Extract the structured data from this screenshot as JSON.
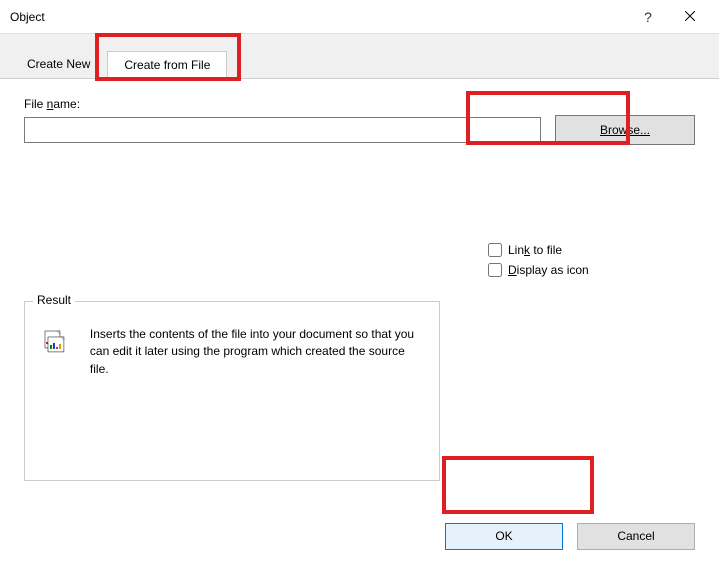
{
  "titlebar": {
    "title": "Object"
  },
  "tabs": {
    "create_new": "Create New",
    "create_from_file": "Create from File"
  },
  "file": {
    "label_pre": "File ",
    "label_key": "n",
    "label_post": "ame:",
    "value": "",
    "browse": "Browse..."
  },
  "options": {
    "link_pre": "Lin",
    "link_key": "k",
    "link_post": " to file",
    "display_key": "D",
    "display_post": "isplay as icon"
  },
  "result": {
    "legend": "Result",
    "text": "Inserts the contents of the file into your document so that you can edit it later using the program which created the source file."
  },
  "buttons": {
    "ok": "OK",
    "cancel": "Cancel"
  }
}
